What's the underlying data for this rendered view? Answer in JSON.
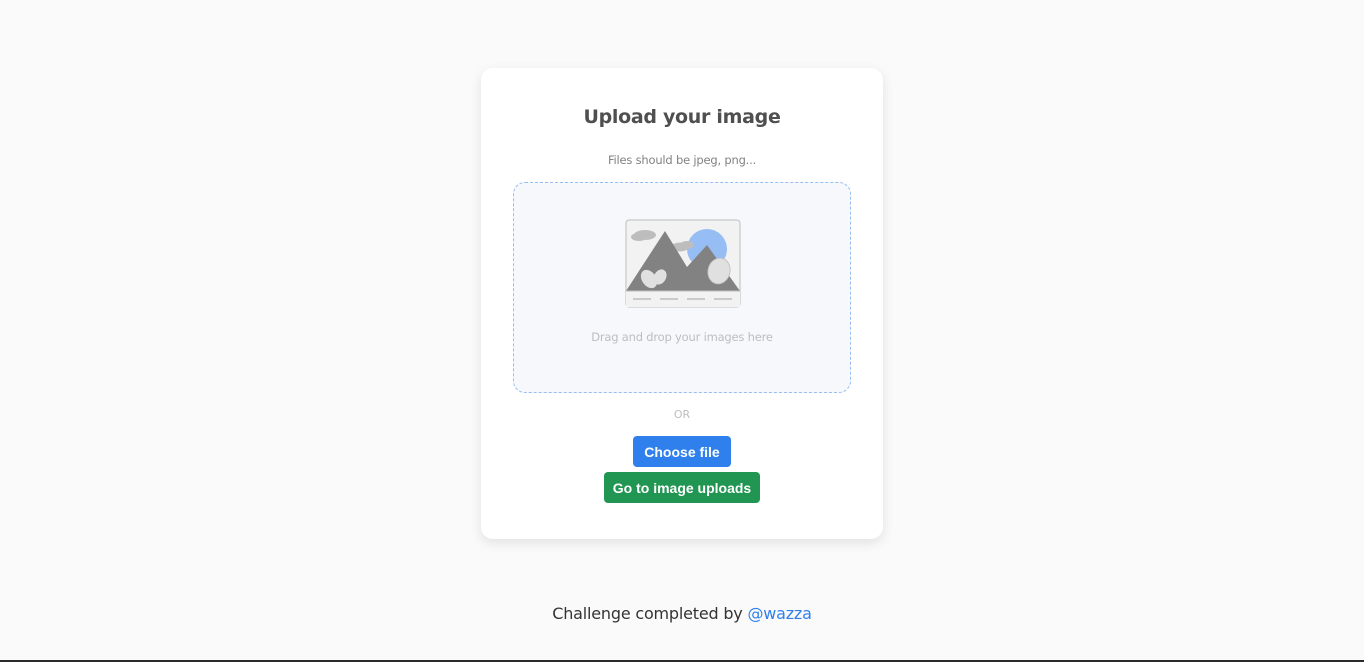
{
  "card": {
    "title": "Upload your image",
    "subtitle": "Files should be jpeg, png...",
    "dropzone_text": "Drag and drop your images here",
    "or_text": "OR",
    "choose_file_label": "Choose file",
    "go_uploads_label": "Go to image uploads",
    "illustration_icon": "image-placeholder-icon"
  },
  "footer": {
    "prefix": "Challenge completed by ",
    "author": "@wazza"
  },
  "colors": {
    "background": "#fafafb",
    "card": "#ffffff",
    "dropzone_bg": "#f6f8fb",
    "dropzone_border": "#97bef4",
    "primary": "#2f80ed",
    "success": "#219653",
    "title": "#4f4f4f",
    "muted": "#bdbdbd"
  }
}
